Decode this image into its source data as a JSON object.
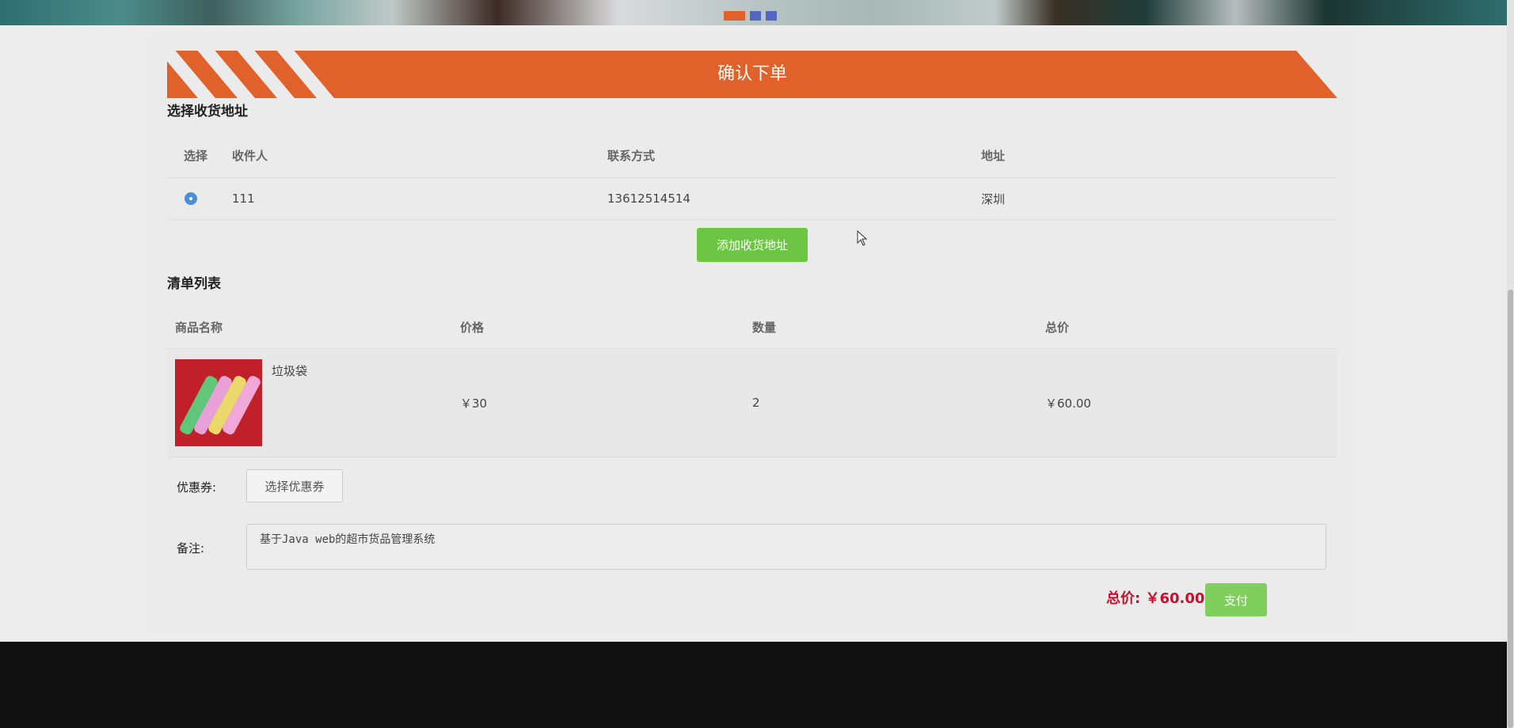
{
  "page": {
    "title": "确认下单",
    "accent_color": "#e0622a",
    "green_color": "#6cc644",
    "price_color": "#c8102e"
  },
  "address_section": {
    "title": "选择收货地址",
    "columns": [
      "选择",
      "收件人",
      "联系方式",
      "地址"
    ],
    "rows": [
      {
        "selected": true,
        "recipient": "111",
        "phone": "13612514514",
        "address": "深圳"
      }
    ],
    "add_button": "添加收货地址"
  },
  "list_section": {
    "title": "清单列表",
    "columns": [
      "商品名称",
      "价格",
      "数量",
      "总价"
    ],
    "items": [
      {
        "name": "垃圾袋",
        "price": "￥30",
        "quantity": "2",
        "total": "￥60.00",
        "icon": "product-thumbnail"
      }
    ]
  },
  "coupon": {
    "label": "优惠券:",
    "button": "选择优惠券"
  },
  "remark": {
    "label": "备注:",
    "value": "基于Java web的超市货品管理系统"
  },
  "summary": {
    "total_label": "总价: ￥60.00",
    "pay_button": "支付"
  }
}
